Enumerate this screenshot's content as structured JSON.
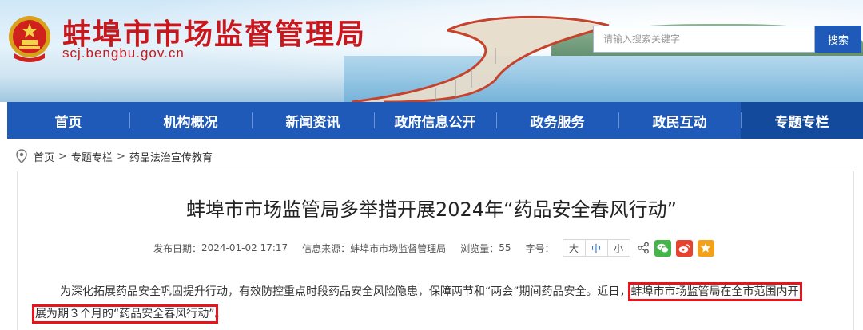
{
  "site": {
    "title": "蚌埠市市场监督管理局",
    "domain": "scj.bengbu.gov.cn"
  },
  "search": {
    "placeholder": "请输入搜索关键字",
    "button_label": "搜索"
  },
  "nav": {
    "items": [
      {
        "label": "首页"
      },
      {
        "label": "机构概况"
      },
      {
        "label": "新闻资讯"
      },
      {
        "label": "政府信息公开"
      },
      {
        "label": "政务服务"
      },
      {
        "label": "政民互动"
      },
      {
        "label": "专题专栏",
        "active": true
      }
    ]
  },
  "breadcrumb": {
    "items": [
      "首页",
      "专题专栏",
      "药品法治宣传教育"
    ],
    "separator": ">"
  },
  "article": {
    "title": "蚌埠市市场监管局多举措开展2024年“药品安全春风行动”",
    "meta": {
      "date_label": "发布日期：",
      "date": "2024-01-02 17:17",
      "source_label": "信息来源：",
      "source": "蚌埠市市场监督管理局",
      "views_label": "浏览量：",
      "views": "55",
      "fontsize_label": "字号：",
      "fontsize_options": [
        "大",
        "中",
        "小"
      ],
      "fontsize_selected": "中"
    },
    "para": {
      "line1_plain": "为深化拓展药品安全巩固提升行动，有效防控重点时段药品安全风险隐患，保障两节和“两会”期间药品安全。近日，",
      "line1_highlight": "蚌埠市市场监管局在全市范围内开",
      "line2_highlight": "展为期３个月的“药品安全春风行动”",
      "line2_plain": "。"
    }
  },
  "colors": {
    "brand_red": "#c8171d",
    "nav_blue": "#1f5ab8",
    "highlight_red": "#e8141b"
  }
}
